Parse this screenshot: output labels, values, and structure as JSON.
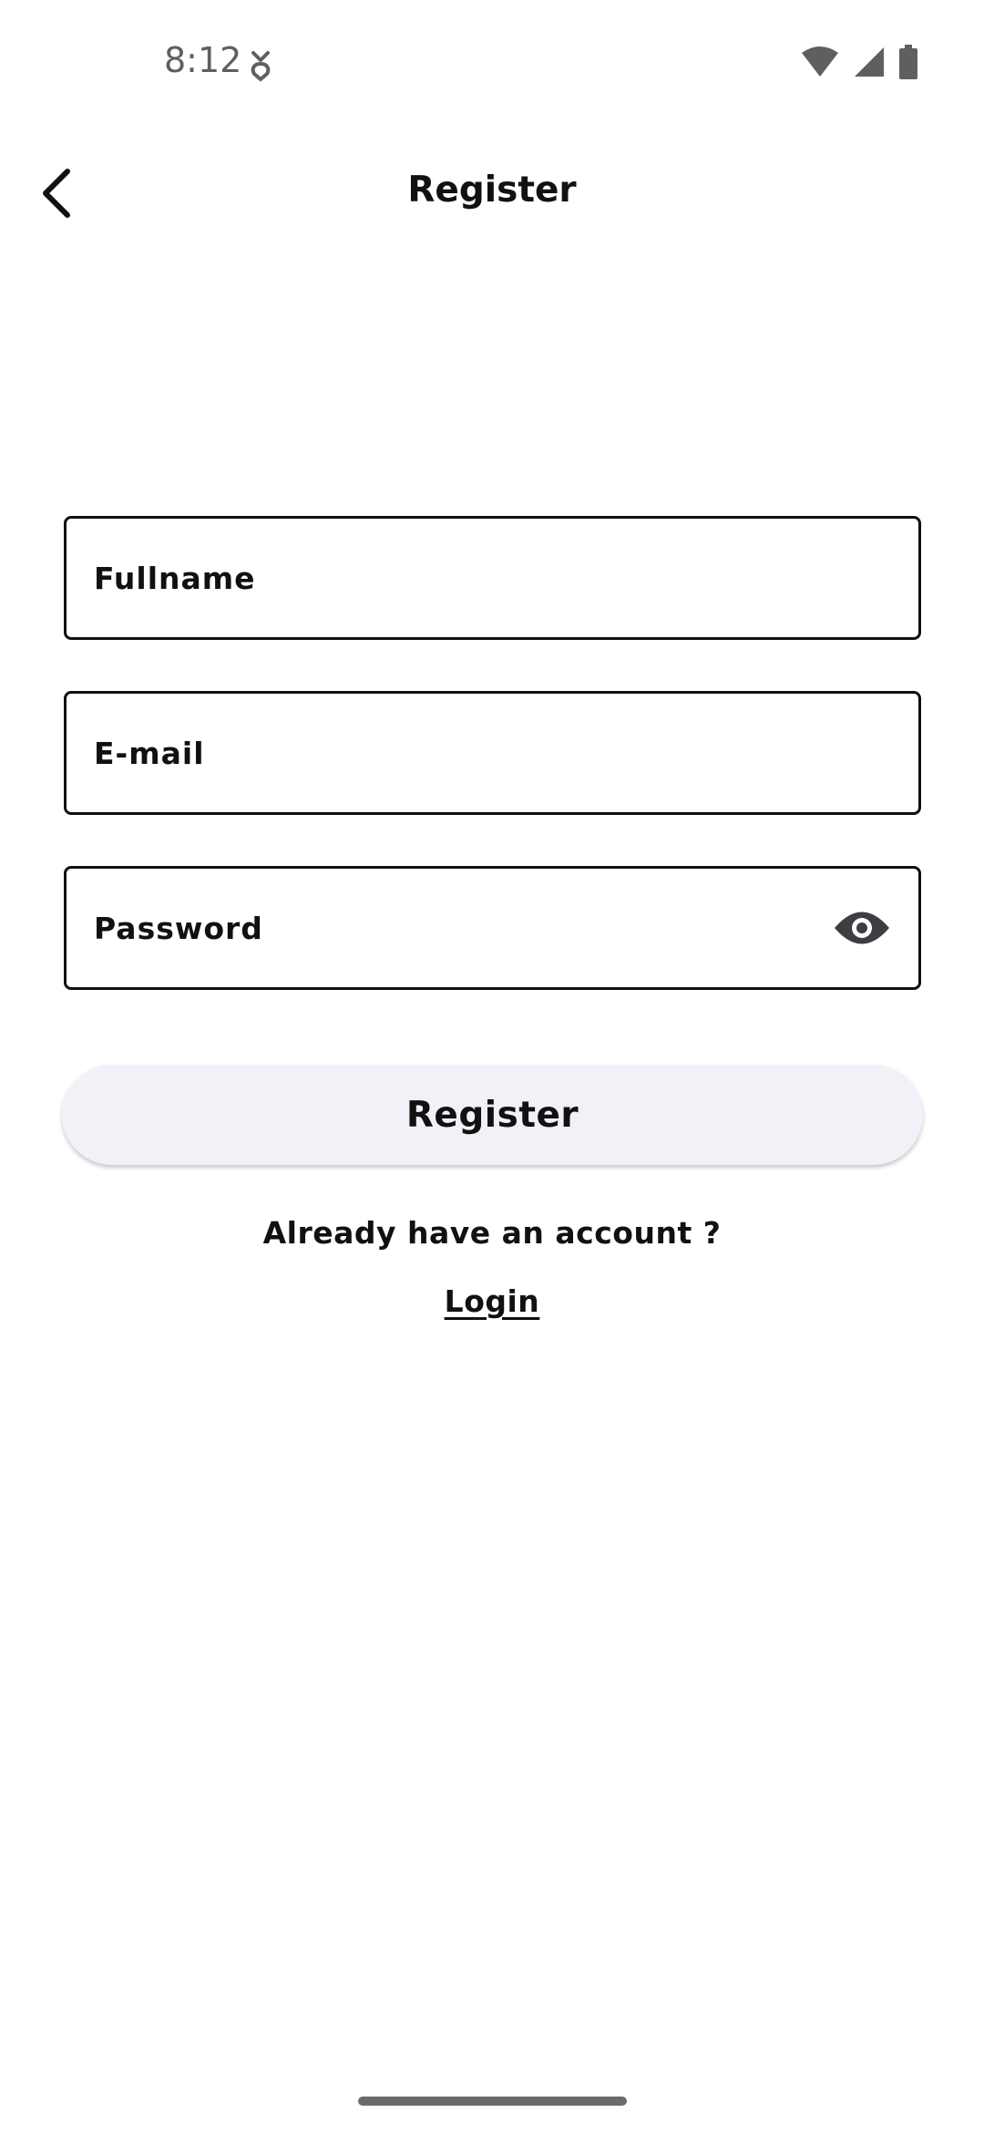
{
  "status_bar": {
    "time": "8:12",
    "icons": [
      "dnd-icon",
      "wifi-icon",
      "cellular-signal-icon",
      "battery-icon"
    ],
    "icon_color": "#5f5f5f"
  },
  "app_bar": {
    "back_icon": "chevron-left-icon",
    "title": "Register"
  },
  "form": {
    "fullname": {
      "placeholder": "Fullname",
      "value": ""
    },
    "email": {
      "placeholder": "E-mail",
      "value": ""
    },
    "password": {
      "placeholder": "Password",
      "value": "",
      "toggle_icon": "eye-icon"
    },
    "submit_label": "Register",
    "submit_bg": "#f4f0f7"
  },
  "footer": {
    "prompt": "Already have an account ?",
    "login_label": "Login"
  }
}
